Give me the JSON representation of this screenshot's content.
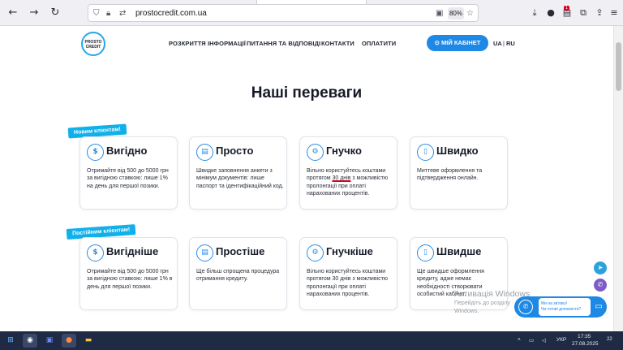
{
  "browser": {
    "url": "prostocredit.com.ua",
    "zoom": "80%",
    "icons": [
      "back-arrow-icon",
      "forward-arrow-icon",
      "reload-icon",
      "shield-icon",
      "lock-icon",
      "permissions-icon",
      "reader-view-icon",
      "bookmark-star-icon",
      "download-icon",
      "extension-icon",
      "menu-icon"
    ]
  },
  "site": {
    "logo_line1": "PROSTO",
    "logo_line2": "CREDIT",
    "nav": [
      "РОЗКРИТТЯ ІНФОРМАЦІЇ",
      "ПИТАННЯ ТА ВІДПОВІДІ",
      "КОНТАКТИ",
      "ОПЛАТИТИ"
    ],
    "cabinet_label": "МІЙ КАБІНЕТ",
    "lang_active": "UA",
    "lang_separator": "|",
    "lang_other": "RU"
  },
  "section_title": "Наші переваги",
  "new_clients": {
    "ribbon": "Новим клієнтам!",
    "cards": [
      {
        "title": "Вигідно",
        "text": "Отримайте від 500 до 5000 грн за вигідною ставкою: лише 1% на день для першої позики."
      },
      {
        "title": "Просто",
        "text": "Швидке заповнення анкети з мінімум документів: лише паспорт та ідентифікаційний код."
      },
      {
        "title": "Гнучко",
        "text_before": "Вільно користуйтесь коштами протягом ",
        "text_highlight": "30 днів",
        "text_after": " з можливістю пролонгації при оплаті нарахованих процентів."
      },
      {
        "title": "Швидко",
        "text": "Миттеве оформлення та підтвердження онлайн."
      }
    ]
  },
  "returning_clients": {
    "ribbon": "Постійним клієнтам!",
    "cards": [
      {
        "title": "Вигідніше",
        "text": "Отримайте від 500 до 5000 грн за вигідною ставкою: лише 1% в день для першої позики."
      },
      {
        "title": "Простіше",
        "text": "Ще більш спрощена процедура отримання кредиту."
      },
      {
        "title": "Гнучкіше",
        "text": "Вільно користуйтесь коштами протягом 30 днів з можливістю пролонгації при оплаті нарахованих процентів."
      },
      {
        "title": "Швидше",
        "text": "Ще швидше оформлення кредиту, адже немає необхідності створювати особистий кабінет."
      }
    ]
  },
  "watermark": {
    "title": "Активація Windows",
    "sub1": "Перейдіть до розділу «Параметри», щоб активувати",
    "sub2": "Windows."
  },
  "chat": {
    "line1": "Ми на зв'язку!",
    "line2": "Чи готові допомогти?"
  },
  "taskbar": {
    "lang": "УКР",
    "time": "17:35",
    "date": "27.08.2025",
    "notif_count": "22"
  },
  "colors": {
    "primary": "#1e88e5",
    "ribbon": "#12b0ea",
    "highlight_underline": "#d0021b"
  }
}
